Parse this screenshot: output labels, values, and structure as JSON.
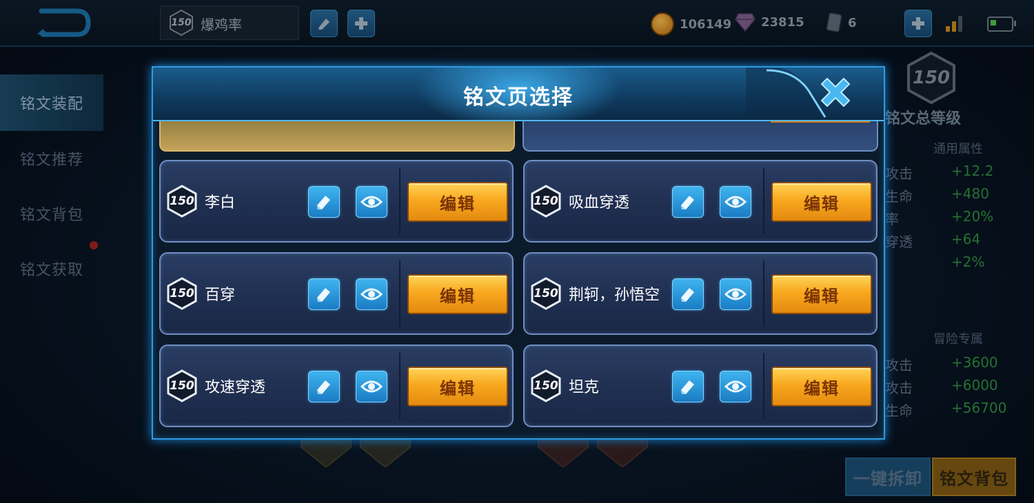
{
  "topbar": {
    "player_level": "150",
    "player_name": "爆鸡率",
    "gold": "106149",
    "diamonds": "23815",
    "cards": "6"
  },
  "left_nav": {
    "items": [
      {
        "label": "铭文装配"
      },
      {
        "label": "铭文推荐"
      },
      {
        "label": "铭文背包"
      },
      {
        "label": "铭文获取"
      }
    ]
  },
  "right_panel": {
    "level": "150",
    "title": "铭文总等级",
    "common_section": "通用属性",
    "common_stats": [
      {
        "label": "攻击",
        "value": "+12.2"
      },
      {
        "label": "生命",
        "value": "+480"
      },
      {
        "label": "率",
        "value": "+20%"
      },
      {
        "label": "穿透",
        "value": "+64"
      },
      {
        "label": "",
        "value": "+2%"
      }
    ],
    "adventure_section": "冒险专属",
    "adventure_stats": [
      {
        "label": "攻击",
        "value": "+3600"
      },
      {
        "label": "攻击",
        "value": "+6000"
      },
      {
        "label": "生命",
        "value": "+56700"
      }
    ]
  },
  "bottom": {
    "unload_label": "一键拆卸",
    "bag_label": "铭文背包"
  },
  "modal": {
    "title": "铭文页选择",
    "pages": [
      {
        "level": "150",
        "name": "李白",
        "edit_label": "编辑"
      },
      {
        "level": "150",
        "name": "吸血穿透",
        "edit_label": "编辑"
      },
      {
        "level": "150",
        "name": "百穿",
        "edit_label": "编辑"
      },
      {
        "level": "150",
        "name": "荆轲，孙悟空",
        "edit_label": "编辑"
      },
      {
        "level": "150",
        "name": "攻速穿透",
        "edit_label": "编辑"
      },
      {
        "level": "150",
        "name": "坦克",
        "edit_label": "编辑"
      }
    ]
  },
  "colors": {
    "modal_border": "#2e9be0",
    "edit_button": "#f8a81e",
    "icon_button": "#1a7cc4",
    "stat_value": "#2f8a3c"
  }
}
